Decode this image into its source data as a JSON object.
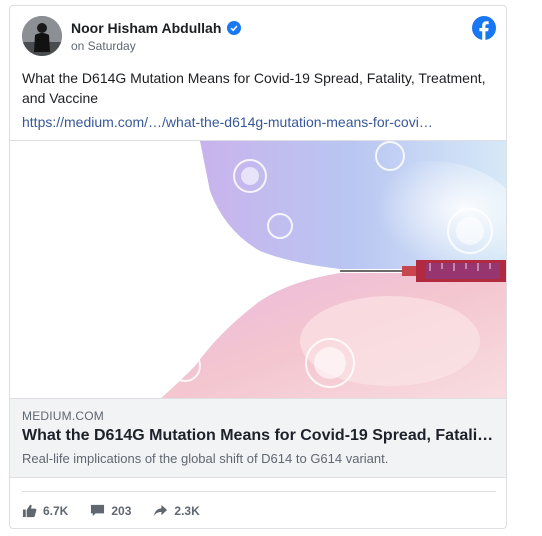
{
  "post": {
    "author": "Noor Hisham Abdullah",
    "time": "on Saturday",
    "text": "What the D614G Mutation Means for Covid-19 Spread, Fatality, Treatment, and Vaccine",
    "link": "https://medium.com/…/what-the-d614g-mutation-means-for-covi…"
  },
  "link_preview": {
    "domain": "MEDIUM.COM",
    "title": "What the D614G Mutation Means for Covid-19 Spread, Fatali…",
    "description": "Real-life implications of the global shift of D614 to G614 variant."
  },
  "stats": {
    "likes": "6.7K",
    "comments": "203",
    "shares": "2.3K"
  },
  "icons": {
    "verified": "verified-badge-icon",
    "facebook": "facebook-logo-icon",
    "like": "thumbs-up-icon",
    "comment": "comment-icon",
    "share": "share-arrow-icon"
  },
  "colors": {
    "brand": "#1877f2",
    "link": "#385898"
  }
}
